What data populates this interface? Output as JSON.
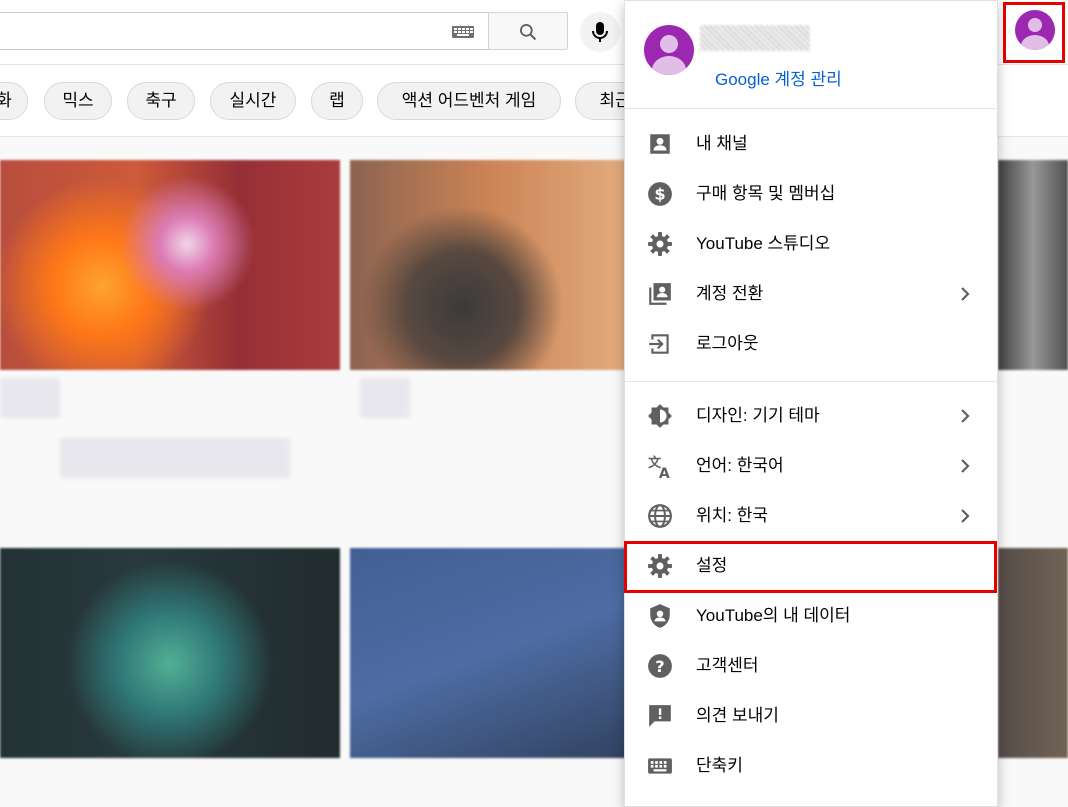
{
  "header": {
    "keyboard_icon": "keyboard-icon",
    "search_icon": "search-icon",
    "mic_icon": "microphone-icon",
    "avatar_icon": "account-avatar-icon"
  },
  "chips": [
    "화",
    "믹스",
    "축구",
    "실시간",
    "랩",
    "액션 어드벤처 게임",
    "최근"
  ],
  "account_menu": {
    "manage_account_label": "Google 계정 관리",
    "section1": [
      {
        "label": "내 채널",
        "icon": "account-box-icon",
        "has_submenu": false
      },
      {
        "label": "구매 항목 및 멤버십",
        "icon": "dollar-icon",
        "has_submenu": false
      },
      {
        "label": "YouTube 스튜디오",
        "icon": "gear-icon",
        "has_submenu": false
      },
      {
        "label": "계정 전환",
        "icon": "switch-account-icon",
        "has_submenu": true
      },
      {
        "label": "로그아웃",
        "icon": "logout-icon",
        "has_submenu": false
      }
    ],
    "section2": [
      {
        "label": "디자인: 기기 테마",
        "icon": "theme-icon",
        "has_submenu": true
      },
      {
        "label": "언어: 한국어",
        "icon": "translate-icon",
        "has_submenu": true
      },
      {
        "label": "위치: 한국",
        "icon": "globe-icon",
        "has_submenu": true
      },
      {
        "label": "설정",
        "icon": "gear-icon",
        "has_submenu": false,
        "highlighted": true
      },
      {
        "label": "YouTube의 내 데이터",
        "icon": "shield-user-icon",
        "has_submenu": false
      },
      {
        "label": "고객센터",
        "icon": "help-icon",
        "has_submenu": false
      },
      {
        "label": "의견 보내기",
        "icon": "feedback-icon",
        "has_submenu": false
      },
      {
        "label": "단축키",
        "icon": "keyboard-icon",
        "has_submenu": false
      }
    ]
  },
  "colors": {
    "link": "#065fd4",
    "highlight_border": "#e60000",
    "avatar": "#9c27b0",
    "icon": "#606060"
  }
}
